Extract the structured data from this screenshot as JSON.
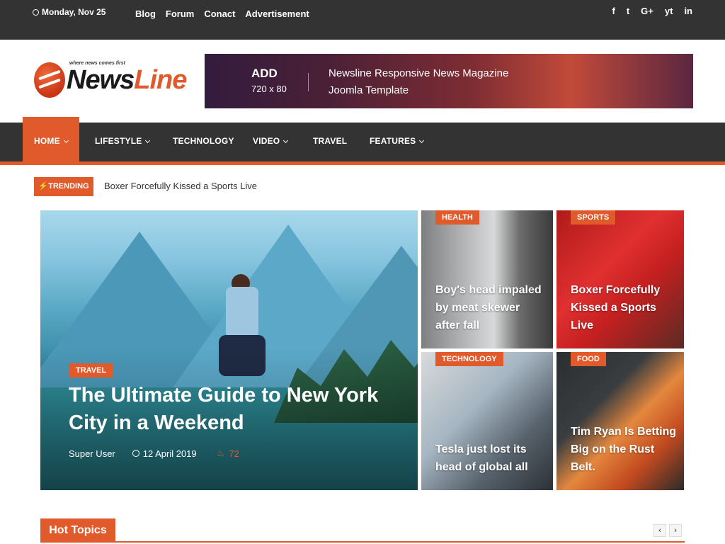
{
  "topbar": {
    "date": "Monday, Nov 25",
    "links": [
      "Blog",
      "Forum",
      "Conact",
      "Advertisement"
    ],
    "social": [
      "f",
      "t",
      "G+",
      "yt",
      "in"
    ]
  },
  "logo": {
    "tagline": "where news comes first",
    "name_part1": "News",
    "name_part2": "Line"
  },
  "ad": {
    "label": "ADD",
    "size": "720 x 80",
    "description": "Newsline Responsive News Magazine Joomla Template"
  },
  "nav": {
    "items": [
      "HOME",
      "LIFESTYLE",
      "TECHNOLOGY",
      "VIDEO",
      "TRAVEL",
      "FEATURES"
    ]
  },
  "trending": {
    "badge": "TRENDING",
    "headline": "Boxer Forcefully Kissed a Sports Live"
  },
  "feature": {
    "category": "TRAVEL",
    "title": "The Ultimate Guide to New York City in a Weekend",
    "author": "Super User",
    "date": "12 April 2019",
    "views": "72"
  },
  "cards": [
    {
      "category": "HEALTH",
      "title": "Boy's head impaled by meat skewer after fall"
    },
    {
      "category": "SPORTS",
      "title": "Boxer Forcefully Kissed a Sports Live"
    },
    {
      "category": "TECHNOLOGY",
      "title": "Tesla just lost its head of global all"
    },
    {
      "category": "FOOD",
      "title": "Tim Ryan Is Betting Big on the Rust Belt."
    }
  ],
  "hot_topics": {
    "label": "Hot Topics",
    "prev": "‹",
    "next": "›"
  },
  "colors": {
    "accent": "#e05a2b",
    "dark": "#333333"
  }
}
